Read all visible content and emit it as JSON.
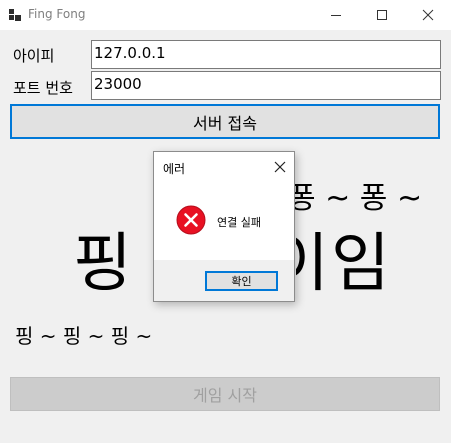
{
  "window": {
    "title": "Fing Fong",
    "icon": "app-icon",
    "controls": [
      "minimize-icon",
      "maximize-icon",
      "close-icon"
    ]
  },
  "form": {
    "ip_label": "아이피",
    "ip_value": "127.0.0.1",
    "port_label": "포트 번호",
    "port_value": "23000",
    "connect_label": "서버 접속"
  },
  "game": {
    "title_left": "핑",
    "title_right": "임",
    "title_partial": "이",
    "pong_text": "퐁 ~ 퐁 ~",
    "ping_text": "핑 ~ 핑 ~ 핑 ~",
    "start_label": "게임 시작",
    "start_enabled": false
  },
  "dialog": {
    "title": "에러",
    "message": "연결 실패",
    "icon": "error-icon",
    "ok_label": "확인"
  },
  "colors": {
    "accent": "#0078d7",
    "error": "#e81123",
    "window_bg": "#f0f0f0"
  }
}
